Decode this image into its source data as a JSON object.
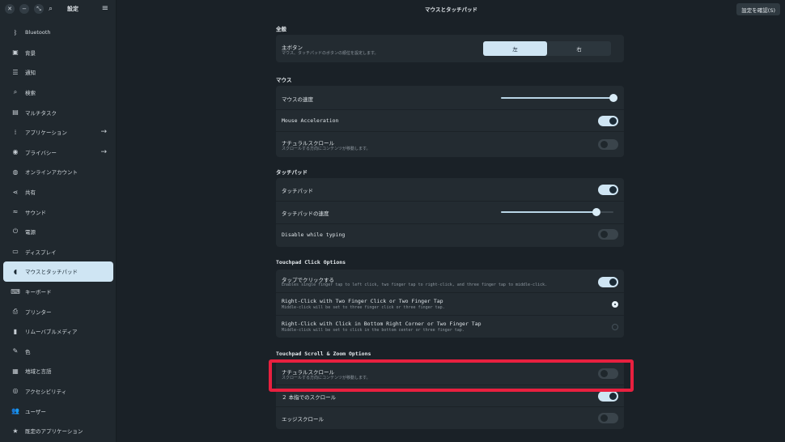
{
  "sidebar": {
    "title": "設定",
    "items": [
      {
        "label": "Bluetooth",
        "icon": "bluetooth-icon",
        "glyph": "ᛒ"
      },
      {
        "label": "背景",
        "icon": "background-icon",
        "glyph": "▣"
      },
      {
        "label": "通知",
        "icon": "notification-icon",
        "glyph": "☰"
      },
      {
        "label": "検索",
        "icon": "search-icon",
        "glyph": "⌕"
      },
      {
        "label": "マルチタスク",
        "icon": "multitask-icon",
        "glyph": "▤"
      },
      {
        "label": "アプリケーション",
        "icon": "apps-icon",
        "glyph": "⁞"
      },
      {
        "label": "プライバシー",
        "icon": "privacy-icon",
        "glyph": "◉"
      },
      {
        "label": "オンラインアカウント",
        "icon": "online-accounts-icon",
        "glyph": "◍"
      },
      {
        "label": "共有",
        "icon": "share-icon",
        "glyph": "⋖"
      },
      {
        "label": "サウンド",
        "icon": "sound-icon",
        "glyph": "≈"
      },
      {
        "label": "電源",
        "icon": "power-icon",
        "glyph": "⏻"
      },
      {
        "label": "ディスプレイ",
        "icon": "display-icon",
        "glyph": "▭"
      },
      {
        "label": "マウスとタッチパッド",
        "icon": "mouse-icon",
        "glyph": "◖"
      },
      {
        "label": "キーボード",
        "icon": "keyboard-icon",
        "glyph": "⌨"
      },
      {
        "label": "プリンター",
        "icon": "printer-icon",
        "glyph": "⎙"
      },
      {
        "label": "リムーバブルメディア",
        "icon": "removable-media-icon",
        "glyph": "▮"
      },
      {
        "label": "色",
        "icon": "color-icon",
        "glyph": "✎"
      },
      {
        "label": "地域と言語",
        "icon": "region-icon",
        "glyph": "▦"
      },
      {
        "label": "アクセシビリティ",
        "icon": "accessibility-icon",
        "glyph": "◎"
      },
      {
        "label": "ユーザー",
        "icon": "users-icon",
        "glyph": "👥"
      },
      {
        "label": "既定のアプリケーション",
        "icon": "default-apps-icon",
        "glyph": "★"
      }
    ]
  },
  "header": {
    "title": "マウスとタッチパッド",
    "confirm_label": "設定を確認(S)"
  },
  "general": {
    "title": "全般",
    "primary_button_label": "主ボタン",
    "primary_button_sub": "マウス、タッチパッドのボタンの順位を設定します。",
    "left": "左",
    "right": "右",
    "selected": "左"
  },
  "mouse": {
    "title": "マウス",
    "speed_label": "マウスの速度",
    "speed_value": 1.0,
    "accel_label": "Mouse Acceleration",
    "accel_on": true,
    "natural_label": "ナチュラルスクロール",
    "natural_sub": "スクロールする方向にコンテンツが移動します。",
    "natural_on": false
  },
  "touchpad": {
    "title": "タッチパッド",
    "enabled_label": "タッチパッド",
    "enabled_on": true,
    "speed_label": "タッチパッドの速度",
    "speed_value": 0.85,
    "dwt_label": "Disable while typing",
    "dwt_on": false
  },
  "click": {
    "title": "Touchpad Click Options",
    "tap_label": "タップでクリックする",
    "tap_sub": "Enables single finger tap to left click, two finger tap to right-click, and three finger tap to middle-click.",
    "tap_on": true,
    "two_finger_label": "Right-Click with Two Finger Click or Two Finger Tap",
    "two_finger_sub": "Middle-click will be set to three finger click or three finger tap.",
    "corner_label": "Right-Click with Click in Bottom Right Corner or Two Finger Tap",
    "corner_sub": "Middle-click will be set to click in the bottom center or three finger tap.",
    "selected": "two_finger"
  },
  "scroll": {
    "title": "Touchpad Scroll & Zoom Options",
    "natural_label": "ナチュラルスクロール",
    "natural_sub": "スクロールする方向にコンテンツが移動します。",
    "natural_on": false,
    "two_finger_label": "２ 本指でのスクロール",
    "two_finger_on": true,
    "edge_label": "エッジスクロール",
    "edge_on": false
  }
}
